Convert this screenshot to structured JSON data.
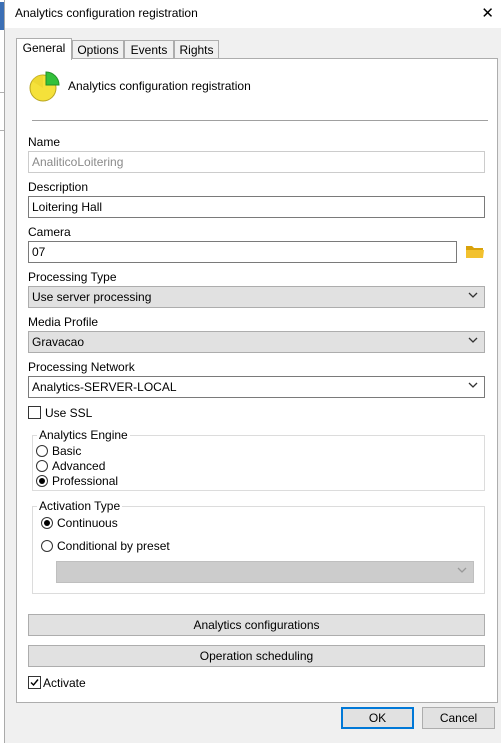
{
  "window": {
    "title": "Analytics configuration registration",
    "close_glyph": "✕"
  },
  "tabs": [
    {
      "label": "General",
      "active": true
    },
    {
      "label": "Options",
      "active": false
    },
    {
      "label": "Events",
      "active": false
    },
    {
      "label": "Rights",
      "active": false
    }
  ],
  "header": {
    "icon": "pie-chart-icon",
    "text": "Analytics configuration registration"
  },
  "form": {
    "name_label": "Name",
    "name_value": "AnaliticoLoitering",
    "description_label": "Description",
    "description_value": "Loitering Hall",
    "camera_label": "Camera",
    "camera_value": "07",
    "camera_browse_icon": "folder-icon",
    "processing_type_label": "Processing Type",
    "processing_type_value": "Use server processing",
    "media_profile_label": "Media Profile",
    "media_profile_value": "Gravacao",
    "processing_network_label": "Processing Network",
    "processing_network_value": "Analytics-SERVER-LOCAL",
    "use_ssl_label": "Use SSL",
    "use_ssl_checked": false
  },
  "engine": {
    "title": "Analytics Engine",
    "options": [
      "Basic",
      "Advanced",
      "Professional"
    ],
    "selected": "Professional"
  },
  "activation": {
    "title": "Activation Type",
    "continuous_label": "Continuous",
    "conditional_label": "Conditional by preset",
    "selected": "Continuous",
    "preset_value": ""
  },
  "buttons": {
    "analytics_configurations": "Analytics configurations",
    "operation_scheduling": "Operation scheduling"
  },
  "activate": {
    "label": "Activate",
    "checked": true
  },
  "footer": {
    "ok": "OK",
    "cancel": "Cancel"
  },
  "colors": {
    "accent": "#0078d7",
    "folder": "#e8b40e",
    "pie_yellow": "#f5e13a",
    "pie_green": "#33c13b"
  }
}
